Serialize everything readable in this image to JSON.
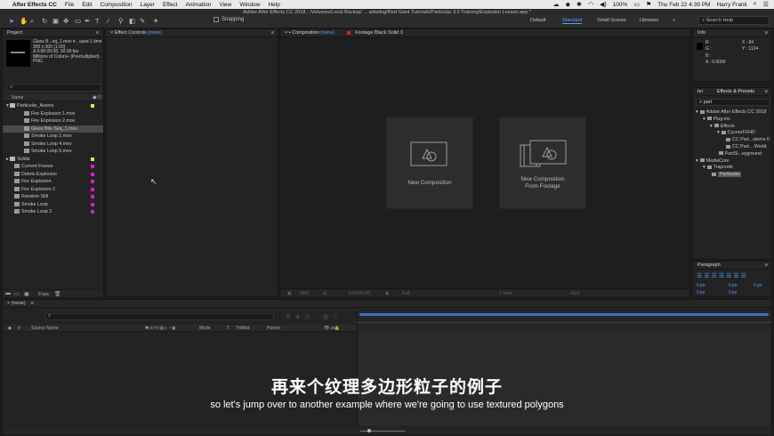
{
  "menubar": {
    "app_name": "After Effects CC",
    "items": [
      "File",
      "Edit",
      "Composition",
      "Layer",
      "Effect",
      "Animation",
      "View",
      "Window",
      "Help"
    ],
    "clock": "Thu Feb 22  4:39 PM",
    "user": "Harry Frank",
    "battery": "100%"
  },
  "window": {
    "title": "Adobe After Effects CC 2018 - /Volumes/Local Backup/ ... arketing/Red Giant Tutorials/Particular 3.0 Training/Explosion Lesson.aep *"
  },
  "toolbar": {
    "snapping_label": "Snapping",
    "workspaces": [
      "Default",
      "Standard",
      "Small Screen",
      "Libraries"
    ],
    "active_workspace": "Standard",
    "search_help_placeholder": "Search Help"
  },
  "project": {
    "tab_label": "Project",
    "selected_name": "Glass B...eq_1.mov ▾ , used 1 time",
    "selected_info": [
      "300 x 300 (1.00)",
      "Δ 0:00:00:08, 30.00 fps",
      "Millions of Colors+ (Premultiplied)",
      "PNG"
    ],
    "search_placeholder": "",
    "column_name": "Name",
    "items": [
      {
        "name": "Particular_Assets",
        "type": "folder",
        "indent": 0,
        "color": "#e6e04a"
      },
      {
        "name": "Fire Explosion 1.mov",
        "type": "file",
        "indent": 1,
        "color": ""
      },
      {
        "name": "Fire Explosion 2.mov",
        "type": "file",
        "indent": 1,
        "color": ""
      },
      {
        "name": "Glass Bits Seq_1.mov",
        "type": "file",
        "indent": 1,
        "color": "",
        "selected": true
      },
      {
        "name": "Smoke Loop 2.mov",
        "type": "file",
        "indent": 1,
        "color": ""
      },
      {
        "name": "Smoke Loop 4.mov",
        "type": "file",
        "indent": 1,
        "color": ""
      },
      {
        "name": "Smoke Loop 5.mov",
        "type": "file",
        "indent": 1,
        "color": ""
      },
      {
        "name": "Solids",
        "type": "folder",
        "indent": 0,
        "color": "#e6e04a"
      },
      {
        "name": "Current Freeze",
        "type": "comp",
        "indent": 0,
        "color": "#d41ec8"
      },
      {
        "name": "Debris Explosion",
        "type": "comp",
        "indent": 0,
        "color": "#d41ec8"
      },
      {
        "name": "Fire Explosion",
        "type": "comp",
        "indent": 0,
        "color": "#d41ec8"
      },
      {
        "name": "Fire Explosion 2",
        "type": "comp",
        "indent": 0,
        "color": "#d41ec8"
      },
      {
        "name": "Random Still",
        "type": "comp",
        "indent": 0,
        "color": "#d41ec8"
      },
      {
        "name": "Smoke Loop",
        "type": "comp",
        "indent": 0,
        "color": "#d41ec8"
      },
      {
        "name": "Smoke Loop 2",
        "type": "comp",
        "indent": 0,
        "color": "#d41ec8"
      }
    ],
    "bpc": "8 bpc"
  },
  "effect_controls": {
    "tab_label": "Effect Controls",
    "tab_value": "(none)"
  },
  "composition": {
    "tab_label": "Composition",
    "tab_value": "(none)",
    "footage_tab": "Footage Black Solid 3",
    "new_comp_label": "New Composition",
    "new_comp_footage_label_1": "New Composition",
    "new_comp_footage_label_2": "From Footage",
    "zoom": "50%",
    "timecode": "0:00:00:00",
    "resolution": "Full",
    "view": "1 View",
    "exposure": "+0.0"
  },
  "info": {
    "tab_label": "Info",
    "r": "R :",
    "g": "G :",
    "b": "B :",
    "a": "A :  0.0000",
    "x": "X :  84",
    "y": "Y :  1124"
  },
  "effects_presets": {
    "tab_prev": "ter",
    "tab_label": "Effects & Presets",
    "search_value": "part",
    "tree": [
      {
        "text": "Adobe After Effects CC 2018",
        "depth": 0
      },
      {
        "text": "Plug-ins",
        "depth": 1
      },
      {
        "text": "Effects",
        "depth": 2
      },
      {
        "text": "CycoreFXHD",
        "depth": 3
      },
      {
        "text": "CC Part...stems II",
        "depth": 4
      },
      {
        "text": "CC Part... World",
        "depth": 4
      },
      {
        "text": "PartSl...eyground",
        "depth": 3
      },
      {
        "text": "MediaCore",
        "depth": 0
      },
      {
        "text": "Trapcode",
        "depth": 1
      },
      {
        "text": "Particular",
        "depth": 2,
        "selected": true
      }
    ]
  },
  "paragraph": {
    "tab_label": "Paragraph",
    "values": [
      "0 px",
      "0 px",
      "0 px",
      "0 px",
      "0 px"
    ]
  },
  "timeline": {
    "tab_label": "(none)",
    "search_placeholder": "",
    "col_source": "Source Name",
    "col_mode": "Mode",
    "col_t": "T",
    "col_trkmat": "TrkMat",
    "col_parent": "Parent"
  },
  "subtitles": {
    "chinese": "再来个纹理多边形粒子的例子",
    "english": "so let's jump over to another example where we're going to use textured polygons"
  },
  "colors": {
    "accent_blue": "#5aa0ff",
    "label_magenta": "#d41ec8",
    "label_yellow": "#e6e04a"
  }
}
